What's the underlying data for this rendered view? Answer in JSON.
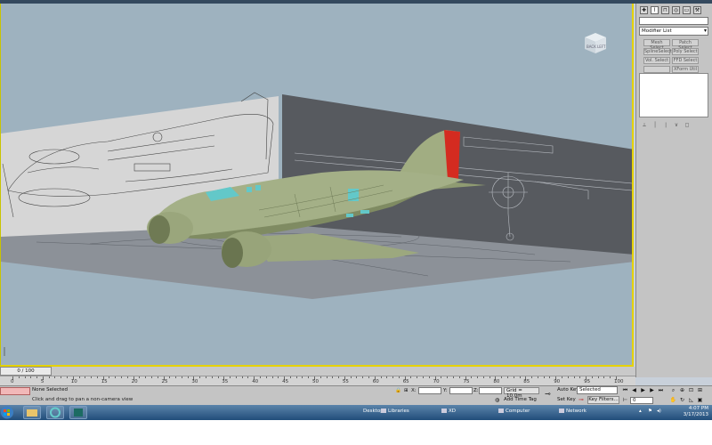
{
  "colors": {
    "viewport_bg": "#9eb2bf",
    "active_border": "#e5d200",
    "fuselage": "#a3af84",
    "rudder": "#d42b20",
    "taskbar": "#2d5c8b"
  },
  "viewport": {
    "viewcube": {
      "front_label": "BACK",
      "side_label": "LEFT"
    }
  },
  "command_panel": {
    "tabs": [
      "create-icon",
      "modify-icon",
      "hierarchy-icon",
      "motion-icon",
      "display-icon",
      "utilities-icon"
    ],
    "modifier_list": "Modifier List",
    "modifier_buttons": [
      "Mesh Select",
      "Patch Select",
      "SplineSelect",
      "Poly Select",
      "Vol. Select",
      "FFD Select",
      "",
      "XForm Util"
    ],
    "stack_tools": [
      "⟂",
      "│",
      "∣",
      "∨",
      "◻"
    ]
  },
  "timeline": {
    "slider_label": "0 / 100",
    "ticks": [
      "0",
      "5",
      "10",
      "15",
      "20",
      "25",
      "30",
      "35",
      "40",
      "45",
      "50",
      "55",
      "60",
      "65",
      "70",
      "75",
      "80",
      "85",
      "90",
      "95",
      "100"
    ],
    "position": 0
  },
  "status": {
    "selection": "None Selected",
    "prompt": "Click and drag to pan a non-camera view",
    "x_label": "X:",
    "y_label": "Y:",
    "z_label": "Z:",
    "grid": "Grid = 10.0m",
    "add_time_tag": "Add Time Tag",
    "auto_key": "Auto Key",
    "selected": "Selected",
    "set_key": "Set Key",
    "key_filters": "Key Filters...",
    "frame": "0"
  },
  "taskbar": {
    "apps": [
      "start-icon",
      "explorer-icon",
      "ie-icon",
      "3dsmax-icon"
    ],
    "desktop_label": "Desktop",
    "libraries": "Libraries",
    "xd": "XD",
    "computer": "Computer",
    "network": "Network",
    "time": "4:07 PM",
    "date": "3/17/2013"
  }
}
